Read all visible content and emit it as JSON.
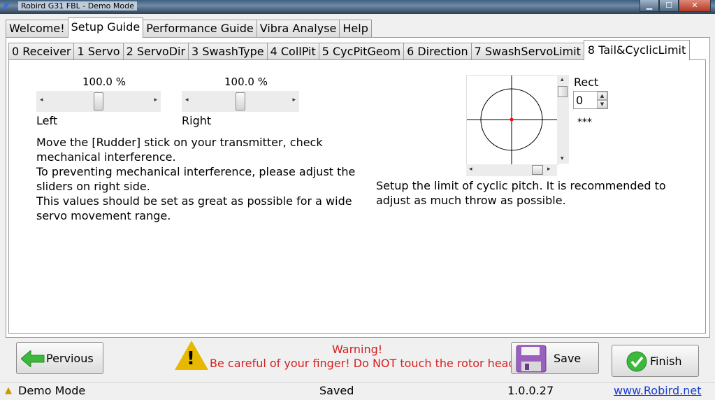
{
  "window": {
    "title": "Robird G31 FBL - Demo Mode",
    "controls": [
      "minimize",
      "maximize",
      "close"
    ]
  },
  "main_tabs": [
    {
      "label": "Welcome!"
    },
    {
      "label": "Setup Guide",
      "active": true
    },
    {
      "label": "Performance Guide"
    },
    {
      "label": "Vibra Analyse"
    },
    {
      "label": "Help"
    }
  ],
  "sub_tabs": [
    {
      "label": "0 Receiver"
    },
    {
      "label": "1 Servo"
    },
    {
      "label": "2 ServoDir"
    },
    {
      "label": "3 SwashType"
    },
    {
      "label": "4 CollPit"
    },
    {
      "label": "5 CycPitGeom"
    },
    {
      "label": "6 Direction"
    },
    {
      "label": "7 SwashServoLimit"
    },
    {
      "label": "8 Tail&CyclicLimit",
      "active": true
    }
  ],
  "left_slider": {
    "value_text": "100.0 %",
    "label": "Left",
    "position": 0.5
  },
  "right_slider": {
    "value_text": "100.0 %",
    "label": "Right",
    "position": 0.5
  },
  "instructions": [
    "Move the [Rudder] stick on your transmitter, check",
    "mechanical interference.",
    "To preventing mechanical interference, please adjust the",
    "sliders on right side.",
    "This values should be set as great as possible for a wide",
    "servo movement range."
  ],
  "cyclic": {
    "rect_label": "Rect",
    "rect_value": "0",
    "stars": "***",
    "description_line1": "Setup the limit of cyclic pitch. It is recommended to",
    "description_line2": "adjust as much throw as possible."
  },
  "buttons": {
    "previous": "Pervious",
    "save": "Save",
    "finish": "Finish"
  },
  "warning": {
    "title": "Warning!",
    "text": "Be careful of your finger! Do NOT touch the rotor head!"
  },
  "status": {
    "mode": "Demo Mode",
    "state": "Saved",
    "version": "1.0.0.27",
    "website": "www.Robird.net"
  },
  "colors": {
    "warning_red": "#d81e1e",
    "link_blue": "#1a3ecf",
    "crosshair_dot": "#e01010"
  }
}
